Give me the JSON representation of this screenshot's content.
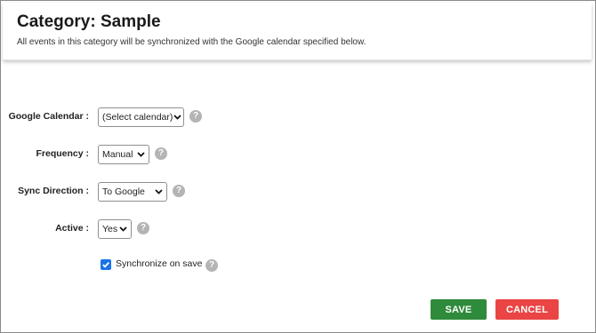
{
  "header": {
    "title": "Category: Sample",
    "subtitle": "All events in this category will be synchronized with the Google calendar specified below."
  },
  "form": {
    "google_calendar": {
      "label": "Google Calendar :",
      "selected": "(Select calendar)",
      "help": "?"
    },
    "frequency": {
      "label": "Frequency :",
      "selected": "Manual",
      "help": "?"
    },
    "sync_direction": {
      "label": "Sync Direction :",
      "selected": "To Google",
      "help": "?"
    },
    "active": {
      "label": "Active :",
      "selected": "Yes",
      "help": "?"
    },
    "sync_on_save": {
      "label": "Synchronize on save",
      "checked": true,
      "help": "?"
    }
  },
  "buttons": {
    "save": "SAVE",
    "cancel": "CANCEL"
  },
  "colors": {
    "save_bg": "#2e8b3c",
    "cancel_bg": "#ea4444",
    "checkbox_bg": "#1a73e8",
    "help_bg": "#b4b4b4"
  }
}
